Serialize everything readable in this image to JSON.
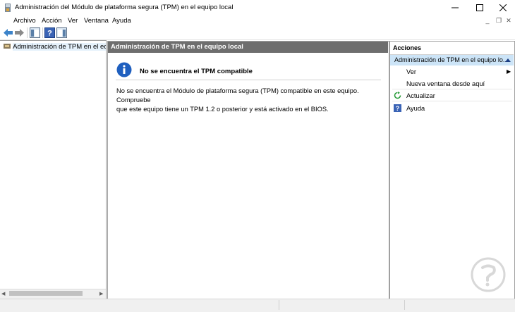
{
  "window": {
    "title": "Administración del Módulo de plataforma segura (TPM) en el equipo local",
    "controls": [
      "minimize",
      "maximize",
      "close"
    ]
  },
  "menu": {
    "items": [
      {
        "label": "Archivo"
      },
      {
        "label": "Acción"
      },
      {
        "label": "Ver"
      },
      {
        "label": "Ventana"
      },
      {
        "label": "Ayuda"
      }
    ]
  },
  "toolbar": {
    "buttons": [
      "back-icon",
      "forward-icon",
      "show-hide-tree-icon",
      "help-icon",
      "show-hide-action-pane-icon"
    ]
  },
  "tree": {
    "item_label": "Administración de TPM en el equipo local"
  },
  "center": {
    "header": "Administración de TPM en el equipo local",
    "info_heading": "No se encuentra el TPM compatible",
    "info_body_line1": "No se encuentra el Módulo de plataforma segura (TPM) compatible en este equipo. Compruebe",
    "info_body_line2": "que este equipo tiene un TPM 1.2 o posterior y está activado en el BIOS."
  },
  "actions": {
    "title": "Acciones",
    "section_label": "Administración de TPM en el equipo lo...",
    "items": [
      {
        "label": "Ver",
        "icon": "none",
        "has_submenu": true
      },
      {
        "label": "Nueva ventana desde aquí",
        "icon": "none"
      },
      {
        "label": "Actualizar",
        "icon": "refresh-icon"
      },
      {
        "label": "Ayuda",
        "icon": "help-icon"
      }
    ]
  },
  "colors": {
    "header_bg": "#6e6e6e",
    "section_bg": "#cce4f7",
    "info_icon": "#1f5fbf"
  }
}
